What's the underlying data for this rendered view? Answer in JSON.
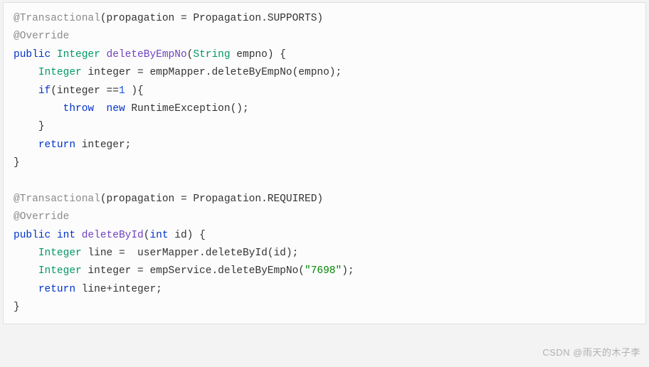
{
  "code": {
    "line1": {
      "at": "@Transactional",
      "openParen": "(",
      "attr": "propagation = Propagation",
      "dot": ".SUPPORTS)",
      "close": ""
    },
    "line2": {
      "at": "@Override"
    },
    "line3": {
      "public": "public",
      "type": " Integer ",
      "method": "deleteByEmpNo",
      "openParen": "(",
      "paramType": "String",
      "paramName": " empno",
      "closeParen": ") {"
    },
    "line4": {
      "indent": "    ",
      "type": "Integer",
      "var": " integer = empMapper.",
      "call": "deleteByEmpNo",
      "rest": "(empno);"
    },
    "line5": {
      "indent": "    ",
      "if": "if",
      "openParen": "(integer ==",
      "num": "1",
      "rest": " ){"
    },
    "line6": {
      "indent": "        ",
      "throw": "throw",
      "space": "  ",
      "new": "new",
      "exc": " RuntimeException();"
    },
    "line7": {
      "indent": "    ",
      "brace": "}"
    },
    "line8": {
      "indent": "    ",
      "return": "return",
      "rest": " integer;"
    },
    "line9": {
      "brace": "}"
    },
    "blank": "",
    "line10": {
      "at": "@Transactional",
      "openParen": "(",
      "attr": "propagation = Propagation",
      "dot": ".REQUIRED)"
    },
    "line11": {
      "at": "@Override"
    },
    "line12": {
      "public": "public",
      "type": " int ",
      "method": "deleteById",
      "openParen": "(",
      "paramType": "int",
      "paramName": " id",
      "closeParen": ") {"
    },
    "line13": {
      "indent": "    ",
      "type": "Integer",
      "var": " line =  userMapper.",
      "call": "deleteById",
      "rest": "(id);"
    },
    "line14": {
      "indent": "    ",
      "type": "Integer",
      "var": " integer = empService.",
      "call": "deleteByEmpNo",
      "openParen": "(",
      "str": "\"7698\"",
      "rest": ");"
    },
    "line15": {
      "indent": "    ",
      "return": "return",
      "rest": " line+integer;"
    },
    "line16": {
      "brace": "}"
    }
  },
  "watermark": "CSDN @雨天的木子李"
}
